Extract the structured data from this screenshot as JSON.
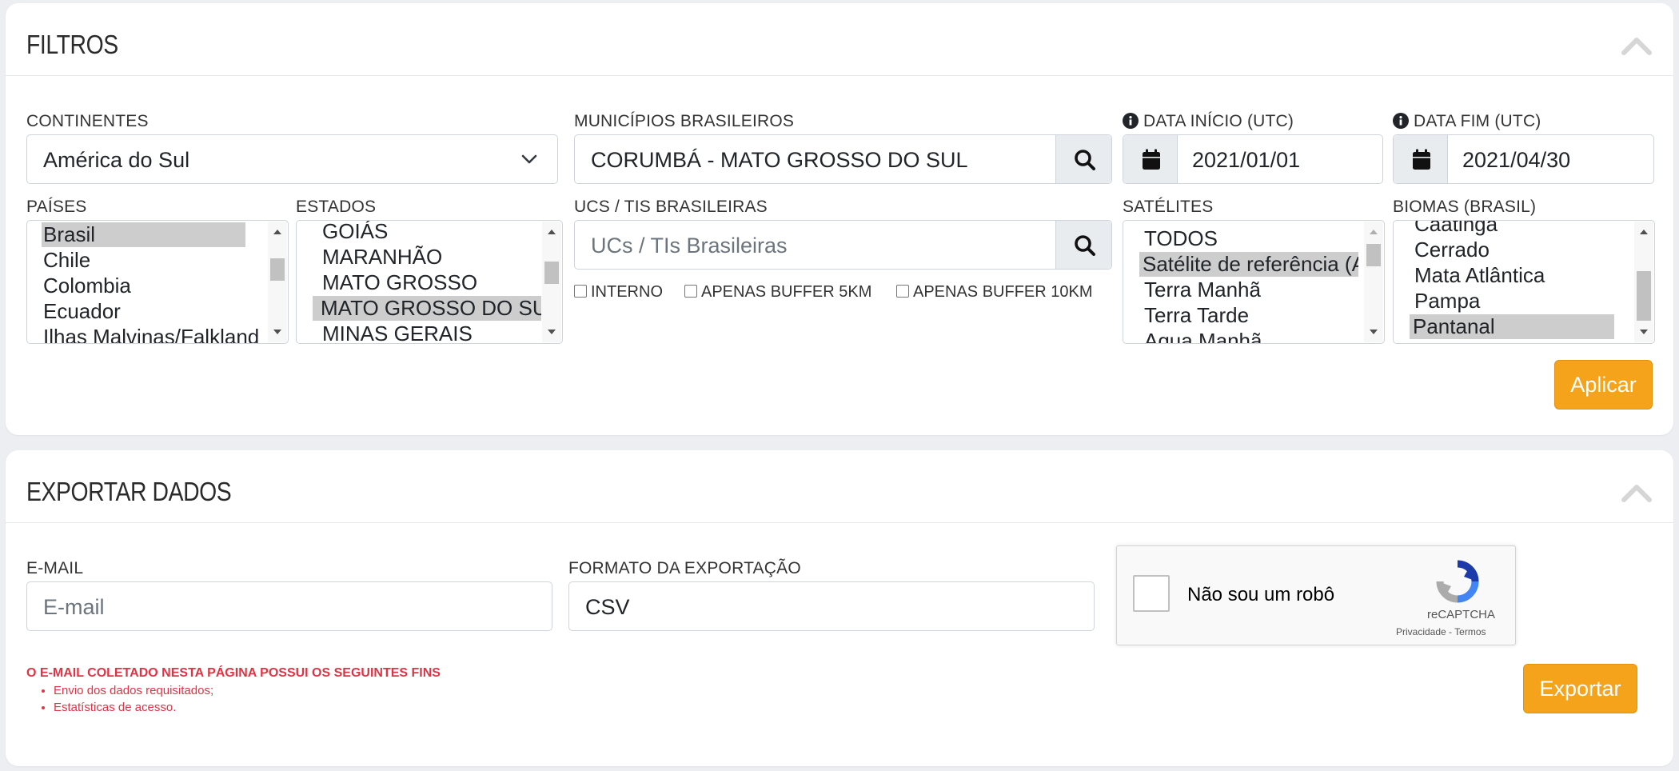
{
  "filtros": {
    "title": "FILTROS",
    "continentes": {
      "label": "CONTINENTES",
      "value": "América do Sul"
    },
    "municipios": {
      "label": "MUNICÍPIOS BRASILEIROS",
      "value": "CORUMBÁ - MATO GROSSO DO SUL"
    },
    "data_inicio": {
      "label": "DATA INÍCIO (UTC)",
      "value": "2021/01/01"
    },
    "data_fim": {
      "label": "DATA FIM (UTC)",
      "value": "2021/04/30"
    },
    "paises": {
      "label": "PAÍSES",
      "options": [
        "Brasil",
        "Chile",
        "Colombia",
        "Ecuador",
        "Ilhas Malvinas/Falkland"
      ],
      "selected": "Brasil"
    },
    "estados": {
      "label": "ESTADOS",
      "options": [
        "GOIÁS",
        "MARANHÃO",
        "MATO GROSSO",
        "MATO GROSSO DO SUL",
        "MINAS GERAIS"
      ],
      "selected": "MATO GROSSO DO SUL"
    },
    "ucs": {
      "label": "UCS / TIS BRASILEIRAS",
      "placeholder": "UCs / TIs Brasileiras"
    },
    "checks": {
      "interno": "INTERNO",
      "buffer5": "APENAS BUFFER 5KM",
      "buffer10": "APENAS BUFFER 10KM"
    },
    "satelites": {
      "label": "SATÉLITES",
      "options": [
        "TODOS",
        "Satélite de referência (A",
        "Terra Manhã",
        "Terra Tarde",
        "Aqua Manhã"
      ],
      "selected": "Satélite de referência (A"
    },
    "biomas": {
      "label": "BIOMAS (BRASIL)",
      "options": [
        "Caatinga",
        "Cerrado",
        "Mata Atlântica",
        "Pampa",
        "Pantanal"
      ],
      "selected": "Pantanal"
    },
    "apply_label": "Aplicar"
  },
  "exportar": {
    "title": "EXPORTAR DADOS",
    "email": {
      "label": "E-MAIL",
      "placeholder": "E-mail"
    },
    "formato": {
      "label": "FORMATO DA EXPORTAÇÃO",
      "value": "CSV"
    },
    "recaptcha": {
      "label": "Não sou um robô",
      "brand": "reCAPTCHA",
      "links": "Privacidade - Termos"
    },
    "notice_title": "O E-MAIL COLETADO NESTA PÁGINA POSSUI OS SEGUINTES FINS",
    "notice_items": [
      "Envio dos dados requisitados;",
      "Estatísticas de acesso."
    ],
    "export_label": "Exportar"
  },
  "colors": {
    "accent": "#f5a31a",
    "warning_text": "#dc3545",
    "page_bg": "#eceef2"
  },
  "icons": [
    "chevron-up-icon",
    "chevron-down-icon",
    "search-icon",
    "calendar-icon",
    "info-icon",
    "recaptcha-logo-icon"
  ]
}
